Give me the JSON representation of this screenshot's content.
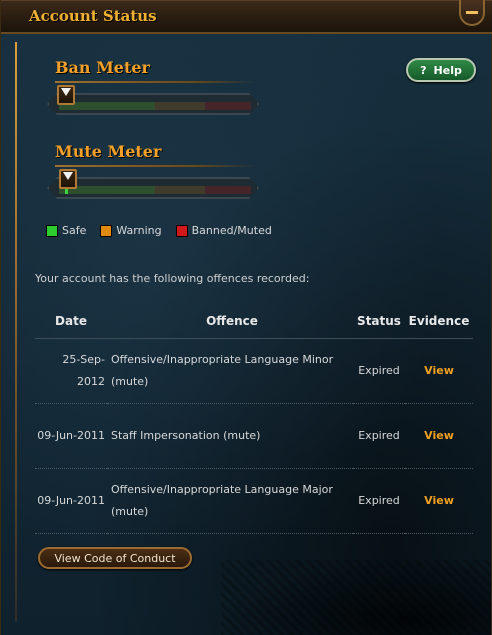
{
  "header": {
    "title": "Account Status"
  },
  "help_button": {
    "label": "Help",
    "icon_glyph": "?"
  },
  "meters": [
    {
      "title": "Ban Meter",
      "level": 0.0
    },
    {
      "title": "Mute Meter",
      "level": 0.05
    }
  ],
  "legend": [
    {
      "label": "Safe",
      "color": "#2ecc2e"
    },
    {
      "label": "Warning",
      "color": "#e08a10"
    },
    {
      "label": "Banned/Muted",
      "color": "#d01818"
    }
  ],
  "intro": "Your account has the following offences recorded:",
  "table": {
    "headers": {
      "date": "Date",
      "offence": "Offence",
      "status": "Status",
      "evidence": "Evidence"
    },
    "rows": [
      {
        "date": "25-Sep-2012",
        "offence": "Offensive/Inappropriate Language Minor (mute)",
        "status": "Expired",
        "evidence": "View"
      },
      {
        "date": "09-Jun-2011",
        "offence": "Staff Impersonation (mute)",
        "status": "Expired",
        "evidence": "View"
      },
      {
        "date": "09-Jun-2011",
        "offence": "Offensive/Inappropriate Language Major (mute)",
        "status": "Expired",
        "evidence": "View"
      }
    ]
  },
  "coc_button": {
    "label": "View Code of Conduct"
  },
  "colors": {
    "accent": "#f2a028",
    "link": "#f0a020",
    "help": "#2f8a46"
  }
}
